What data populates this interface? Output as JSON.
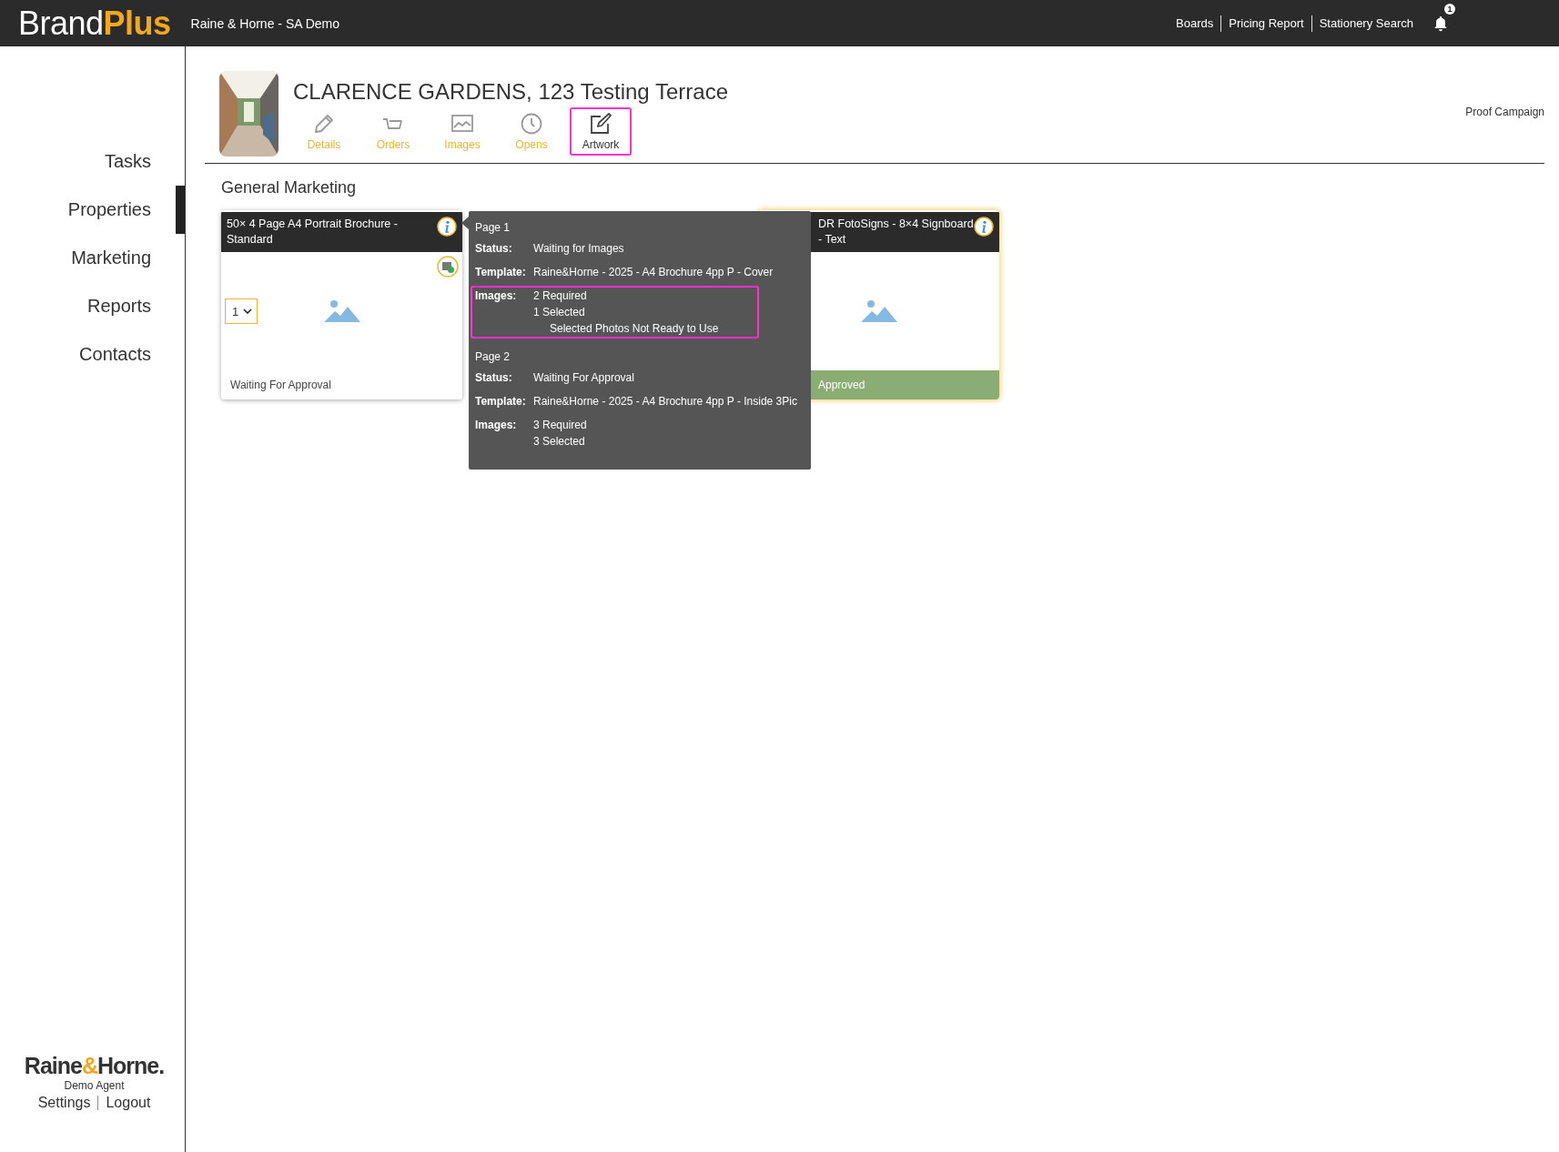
{
  "topbar": {
    "logo": {
      "first": "Brand",
      "second": "Plus"
    },
    "account": "Raine & Horne - SA Demo",
    "links": [
      "Boards",
      "Pricing Report",
      "Stationery Search"
    ],
    "notification_count": "1"
  },
  "sidebar": {
    "items": [
      {
        "label": "Tasks",
        "selected": false
      },
      {
        "label": "Properties",
        "selected": true
      },
      {
        "label": "Marketing",
        "selected": false
      },
      {
        "label": "Reports",
        "selected": false
      },
      {
        "label": "Contacts",
        "selected": false
      }
    ],
    "footer": {
      "brand": {
        "first": "Raine",
        "amp": "&",
        "second": "Horne."
      },
      "user": "Demo Agent",
      "links": [
        "Settings",
        "Logout"
      ]
    }
  },
  "property": {
    "title": "CLARENCE GARDENS, 123 Testing Terrace",
    "action": "Proof Campaign",
    "tabs": [
      {
        "label": "Details",
        "selected": false,
        "highlighted": false
      },
      {
        "label": "Orders",
        "selected": false,
        "highlighted": false
      },
      {
        "label": "Images",
        "selected": false,
        "highlighted": false
      },
      {
        "label": "Opens",
        "selected": false,
        "highlighted": false
      },
      {
        "label": "Artwork",
        "selected": true,
        "highlighted": true
      }
    ]
  },
  "section_title": "General Marketing",
  "cards": [
    {
      "title": "50× 4 Page A4 Portrait Brochure - Standard",
      "glow": false,
      "image_button": true,
      "quantity": "1",
      "status": "Waiting For Approval",
      "approved": false
    },
    {
      "title": "DR FotoSigns - 8×4 Signboard - Text",
      "glow": true,
      "image_button": false,
      "status": "Approved",
      "approved": true
    }
  ],
  "tooltip": {
    "pages": [
      {
        "title": "Page 1",
        "rows": [
          {
            "label": "Status:",
            "values": [
              "Waiting for Images"
            ],
            "highlighted": false
          },
          {
            "label": "Template:",
            "values": [
              "Raine&Horne - 2025 - A4 Brochure 4pp P - Cover"
            ],
            "highlighted": false
          },
          {
            "label": "Images:",
            "values": [
              "2 Required",
              "1 Selected"
            ],
            "note": "Selected Photos Not Ready to Use",
            "highlighted": true
          }
        ]
      },
      {
        "title": "Page 2",
        "rows": [
          {
            "label": "Status:",
            "values": [
              "Waiting For Approval"
            ],
            "highlighted": false
          },
          {
            "label": "Template:",
            "values": [
              "Raine&Horne - 2025 - A4 Brochure 4pp P - Inside 3Pic"
            ],
            "highlighted": false
          },
          {
            "label": "Images:",
            "values": [
              "3 Required",
              "3 Selected"
            ],
            "highlighted": false
          }
        ]
      }
    ]
  }
}
